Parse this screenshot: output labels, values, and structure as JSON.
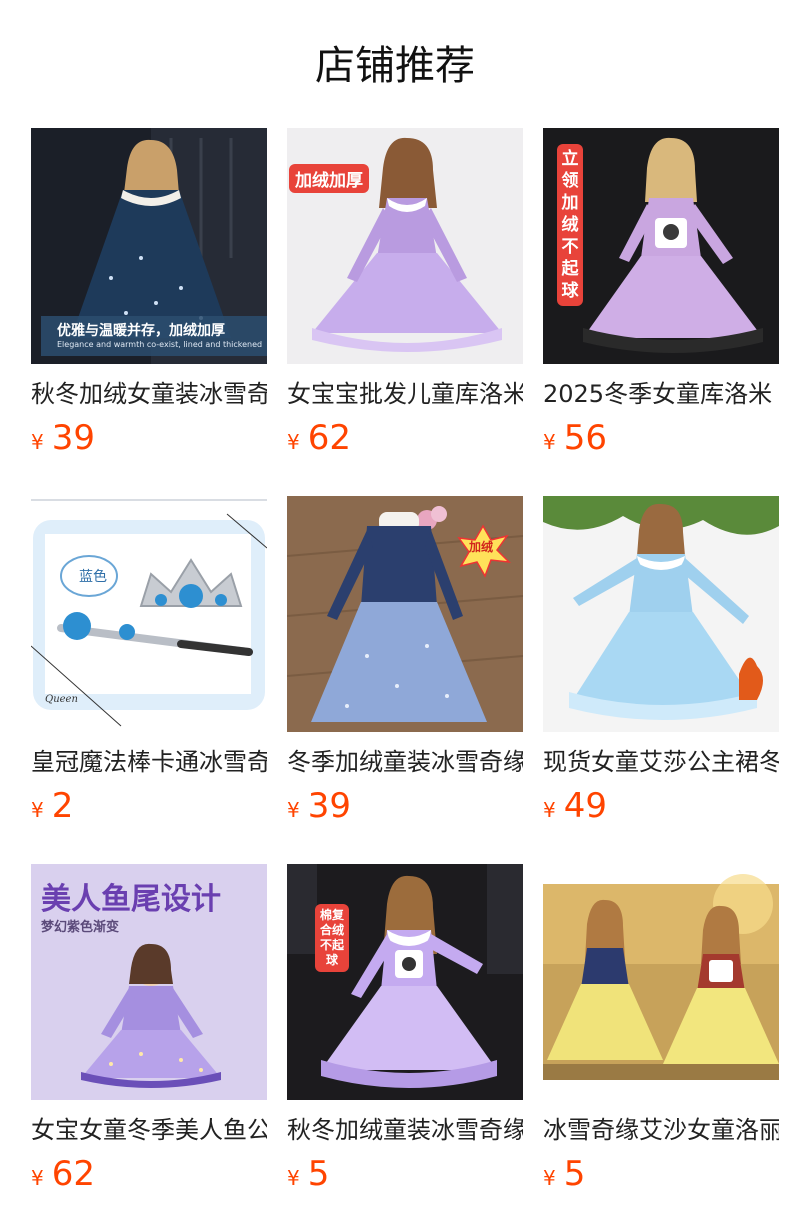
{
  "page": {
    "title": "店铺推荐"
  },
  "currency_symbol": "¥",
  "products": [
    {
      "title": "秋冬加绒女童装冰雪奇缘",
      "price": "39",
      "image_text": {
        "caption": "优雅与温暖并存，加绒加厚",
        "caption_en": "Elegance and warmth co-exist, lined and thickened"
      },
      "colors": {
        "bg": "#1b1f28",
        "dress": "#1e3a5a",
        "accent": "#f2efe9"
      }
    },
    {
      "title": "女宝宝批发儿童库洛米",
      "price": "62",
      "image_text": {
        "badge": "加绒加厚"
      },
      "colors": {
        "bg": "#efeef0",
        "dress": "#b99be0",
        "accent": "#ffffff"
      }
    },
    {
      "title": "2025冬季女童库洛米",
      "price": "56",
      "image_text": {
        "badge": "立领加绒不起球"
      },
      "colors": {
        "bg": "#1a1a1c",
        "dress": "#c9a6e0",
        "accent": "#2a2a2a"
      }
    },
    {
      "title": "皇冠魔法棒卡通冰雪奇缘",
      "price": "2",
      "image_text": {
        "label": "蓝色",
        "signature": "Queen"
      },
      "colors": {
        "bg": "#dfeefa",
        "dress": "#2d8fd1",
        "accent": "#c8ccd2"
      }
    },
    {
      "title": "冬季加绒童装冰雪奇缘",
      "price": "39",
      "image_text": {
        "badge": "加绒"
      },
      "colors": {
        "bg": "#8b6a4e",
        "dress": "#8fa8d8",
        "accent": "#2b3f6e"
      }
    },
    {
      "title": "现货女童艾莎公主裙冬",
      "price": "49",
      "image_text": {},
      "colors": {
        "bg": "#f4f4f4",
        "dress": "#9fd0ee",
        "accent": "#5a8a3a"
      }
    },
    {
      "title": "女宝女童冬季美人鱼公主",
      "price": "62",
      "image_text": {
        "headline": "美人鱼尾设计",
        "sub": "梦幻紫色渐变"
      },
      "colors": {
        "bg": "#d9d0ee",
        "dress": "#a58fe0",
        "accent": "#6a4fb8"
      }
    },
    {
      "title": "秋冬加绒童装冰雪奇缘",
      "price": "5",
      "image_text": {
        "badge": "棉复合绒不起球"
      },
      "colors": {
        "bg": "#1c1b1e",
        "dress": "#c4aaf0",
        "accent": "#ffffff"
      }
    },
    {
      "title": "冰雪奇缘艾沙女童洛丽塔",
      "price": "5",
      "image_text": {},
      "colors": {
        "bg": "#c7a25a",
        "dress": "#f0e37a",
        "accent": "#2c3a6e"
      }
    }
  ]
}
